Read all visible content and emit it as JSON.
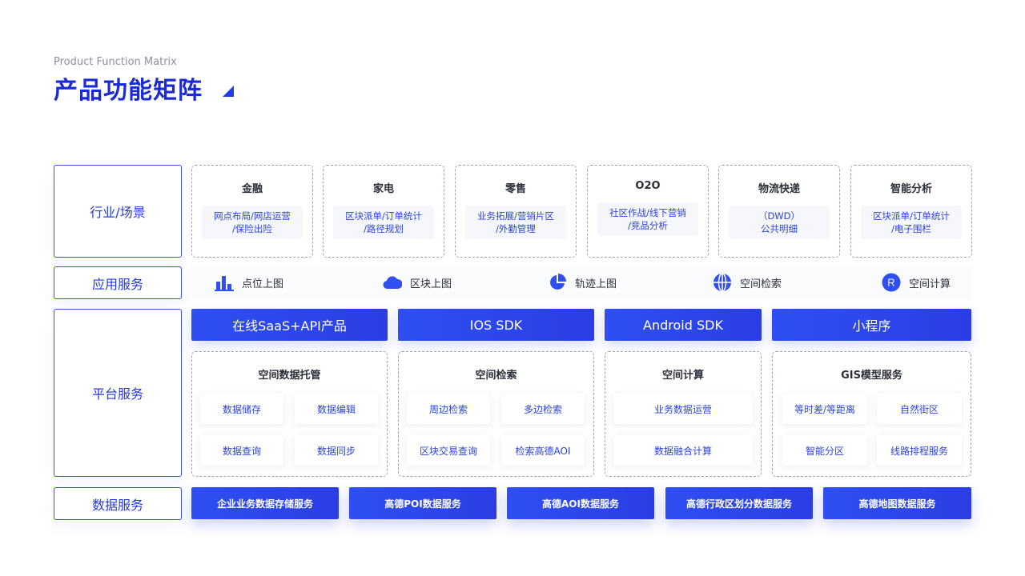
{
  "header": {
    "subtitle": "Product Function Matrix",
    "title": "产品功能矩阵"
  },
  "rows": {
    "industry": "行业/场景",
    "application": "应用服务",
    "platform": "平台服务",
    "data": "数据服务"
  },
  "industries": [
    {
      "title": "金融",
      "desc1": "网点布局/网店运营",
      "desc2": "/保险出险"
    },
    {
      "title": "家电",
      "desc1": "区块派单/订单统计",
      "desc2": "/路径规划"
    },
    {
      "title": "零售",
      "desc1": "业务拓展/营销片区",
      "desc2": "/外勤管理"
    },
    {
      "title": "O2O",
      "desc1": "社区作战/线下营销",
      "desc2": "/竞品分析"
    },
    {
      "title": "物流快递",
      "desc1": "（DWD）",
      "desc2": "公共明细"
    },
    {
      "title": "智能分析",
      "desc1": "区块派单/订单统计",
      "desc2": "/电子围栏"
    }
  ],
  "apps": [
    {
      "label": "点位上图",
      "icon": "bar-chart-icon"
    },
    {
      "label": "区块上图",
      "icon": "cloud-icon"
    },
    {
      "label": "轨迹上图",
      "icon": "pie-chart-icon"
    },
    {
      "label": "空间检索",
      "icon": "globe-icon"
    },
    {
      "label": "空间计算",
      "icon": "r-circle-icon",
      "glyph": "R"
    }
  ],
  "products": [
    "在线SaaS+API产品",
    "IOS SDK",
    "Android SDK",
    "小程序"
  ],
  "platform_groups": [
    {
      "title": "空间数据托管",
      "items": [
        "数据储存",
        "数据编辑",
        "数据查询",
        "数据同步"
      ]
    },
    {
      "title": "空间检索",
      "items": [
        "周边检索",
        "多边检索",
        "区块交易查询",
        "检索高德AOI"
      ]
    },
    {
      "title": "空间计算",
      "items": [
        "业务数据运营",
        "数据融合计算"
      ]
    },
    {
      "title": "GIS模型服务",
      "items": [
        "等时差/等距离",
        "自然街区",
        "智能分区",
        "线路排程服务"
      ]
    }
  ],
  "data_services": [
    "企业业务数据存储服务",
    "高德POI数据服务",
    "高德AOI数据服务",
    "高德行政区划分数据服务",
    "高德地图数据服务"
  ],
  "colors": {
    "brand": "#2a3ee4",
    "title": "#1a2bd6",
    "chip_text": "#2b44dc"
  }
}
